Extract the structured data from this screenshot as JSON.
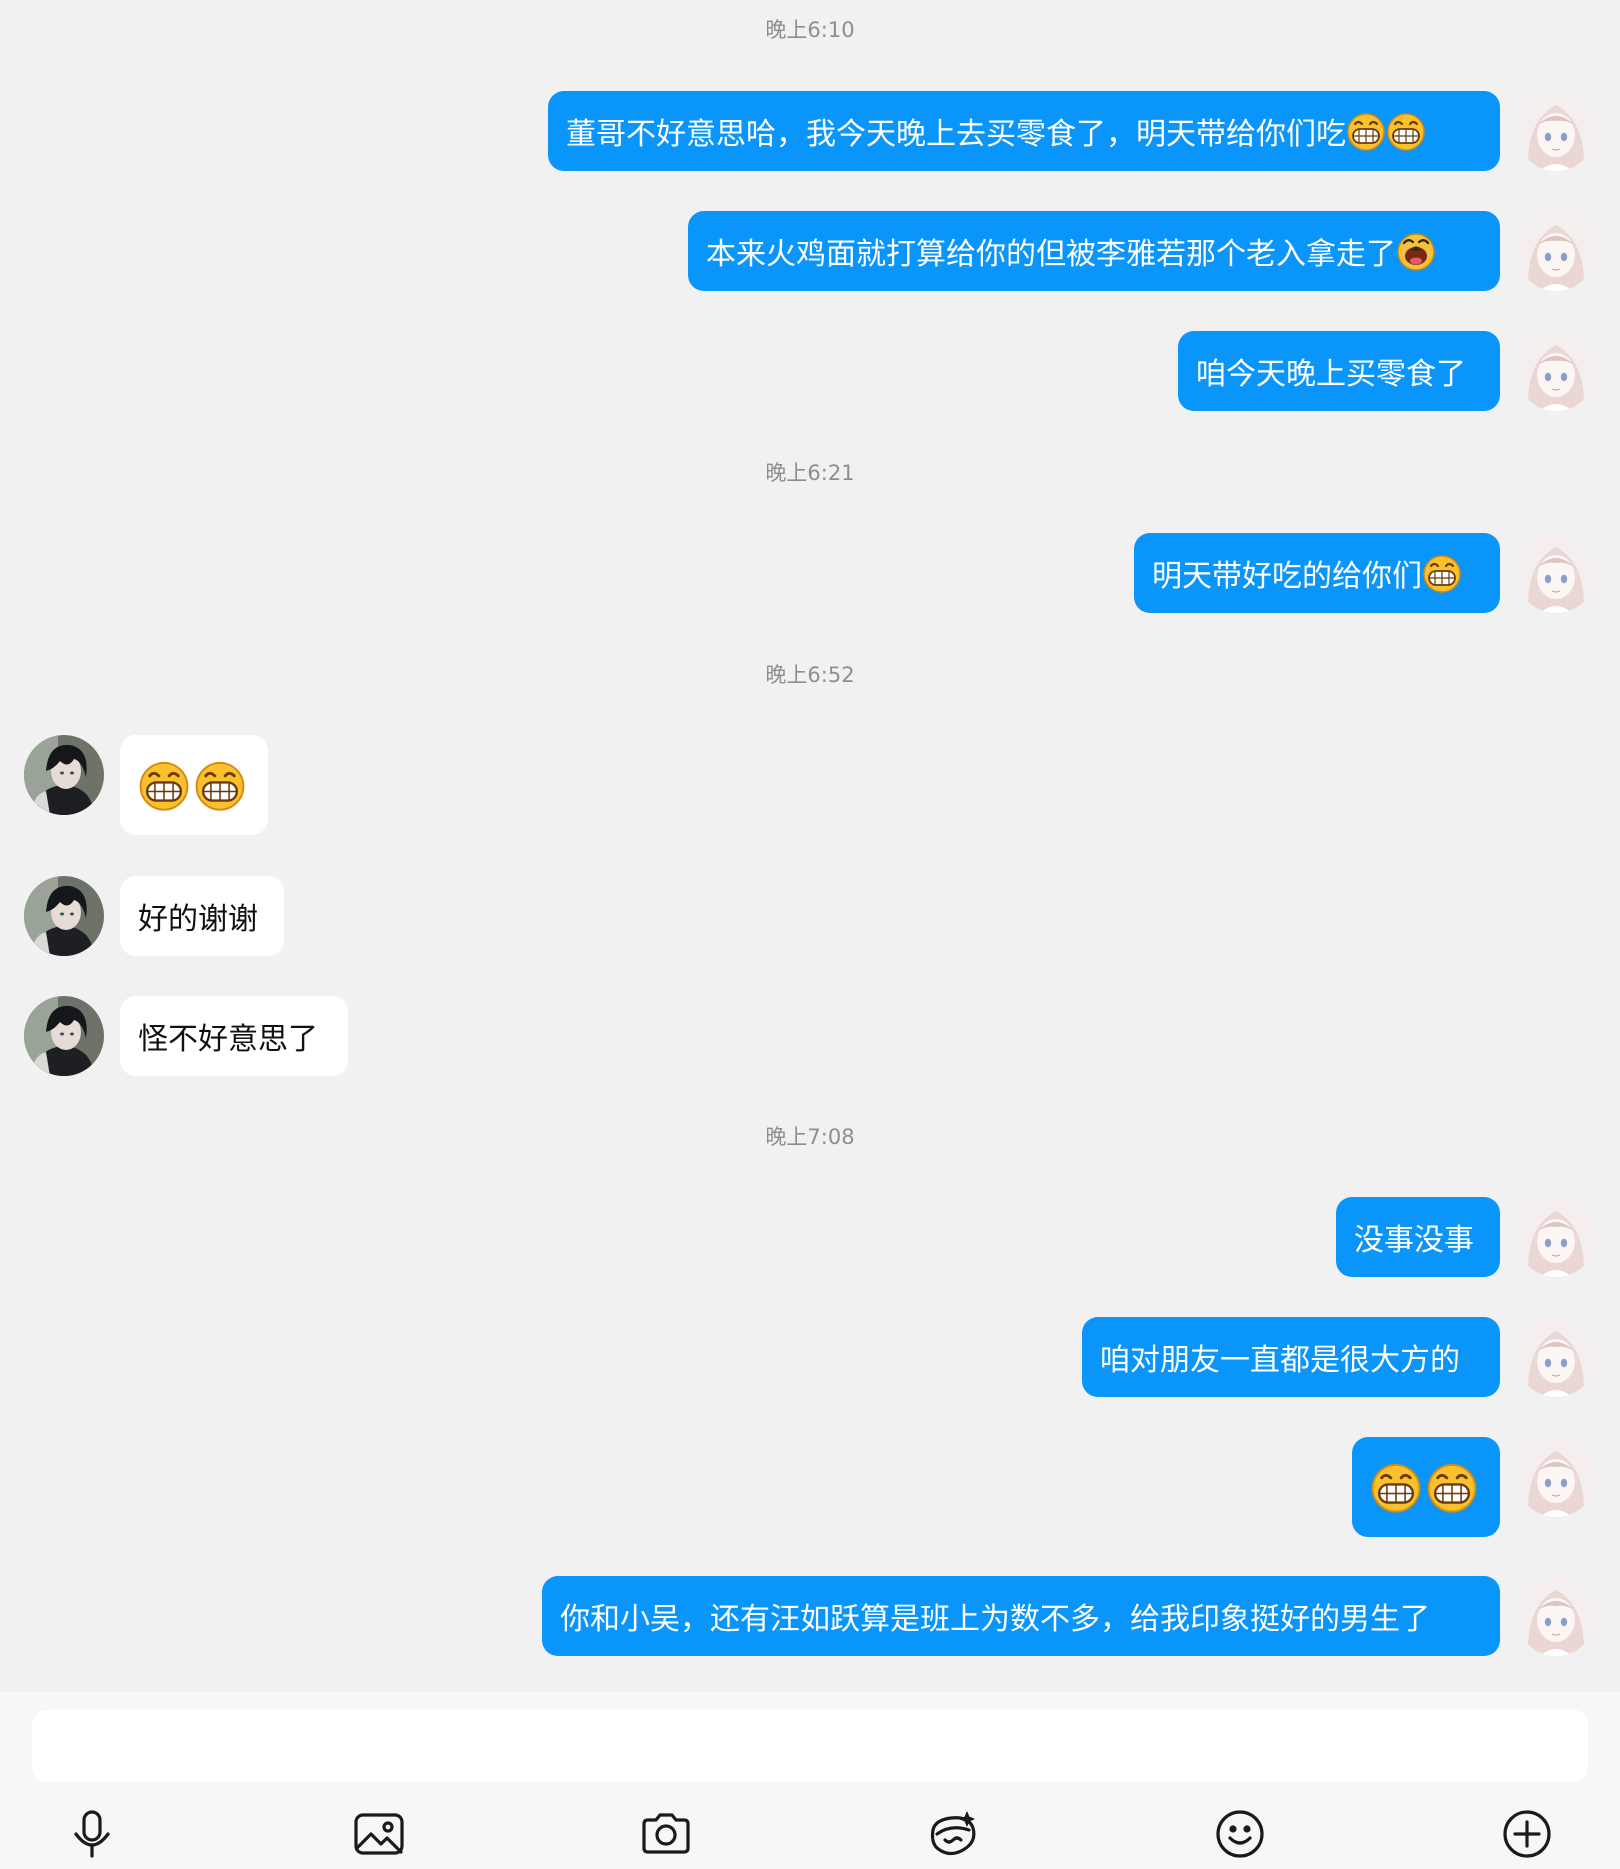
{
  "timestamps": [
    "晚上6:10",
    "晚上6:21",
    "晚上6:52",
    "晚上7:08"
  ],
  "messages": {
    "m1": "董哥不好意思哈，我今天晚上去买零食了，明天带给你们吃",
    "m2": "本来火鸡面就打算给你的但被李雅若那个老入拿走了",
    "m3": "咱今天晚上买零食了",
    "m4": "明天带好吃的给你们",
    "r2": "好的谢谢",
    "r3": "怪不好意思了",
    "m5": "没事没事",
    "m6": "咱对朋友一直都是很大方的",
    "m8": "你和小吴，还有汪如跃算是班上为数不多，给我印象挺好的男生了"
  },
  "emoji_names": {
    "grin": "grinning-face-emoji",
    "laugh": "laughing-dog-emoji"
  },
  "colors": {
    "outgoing_bubble": "#0a95fa",
    "incoming_bubble": "#ffffff",
    "background": "#f1f1f1",
    "timestamp": "#8e8e8e"
  },
  "composer": {
    "input_value": "",
    "tools": [
      "microphone-icon",
      "image-icon",
      "camera-icon",
      "red-packet-icon",
      "smiley-icon",
      "plus-icon"
    ]
  }
}
